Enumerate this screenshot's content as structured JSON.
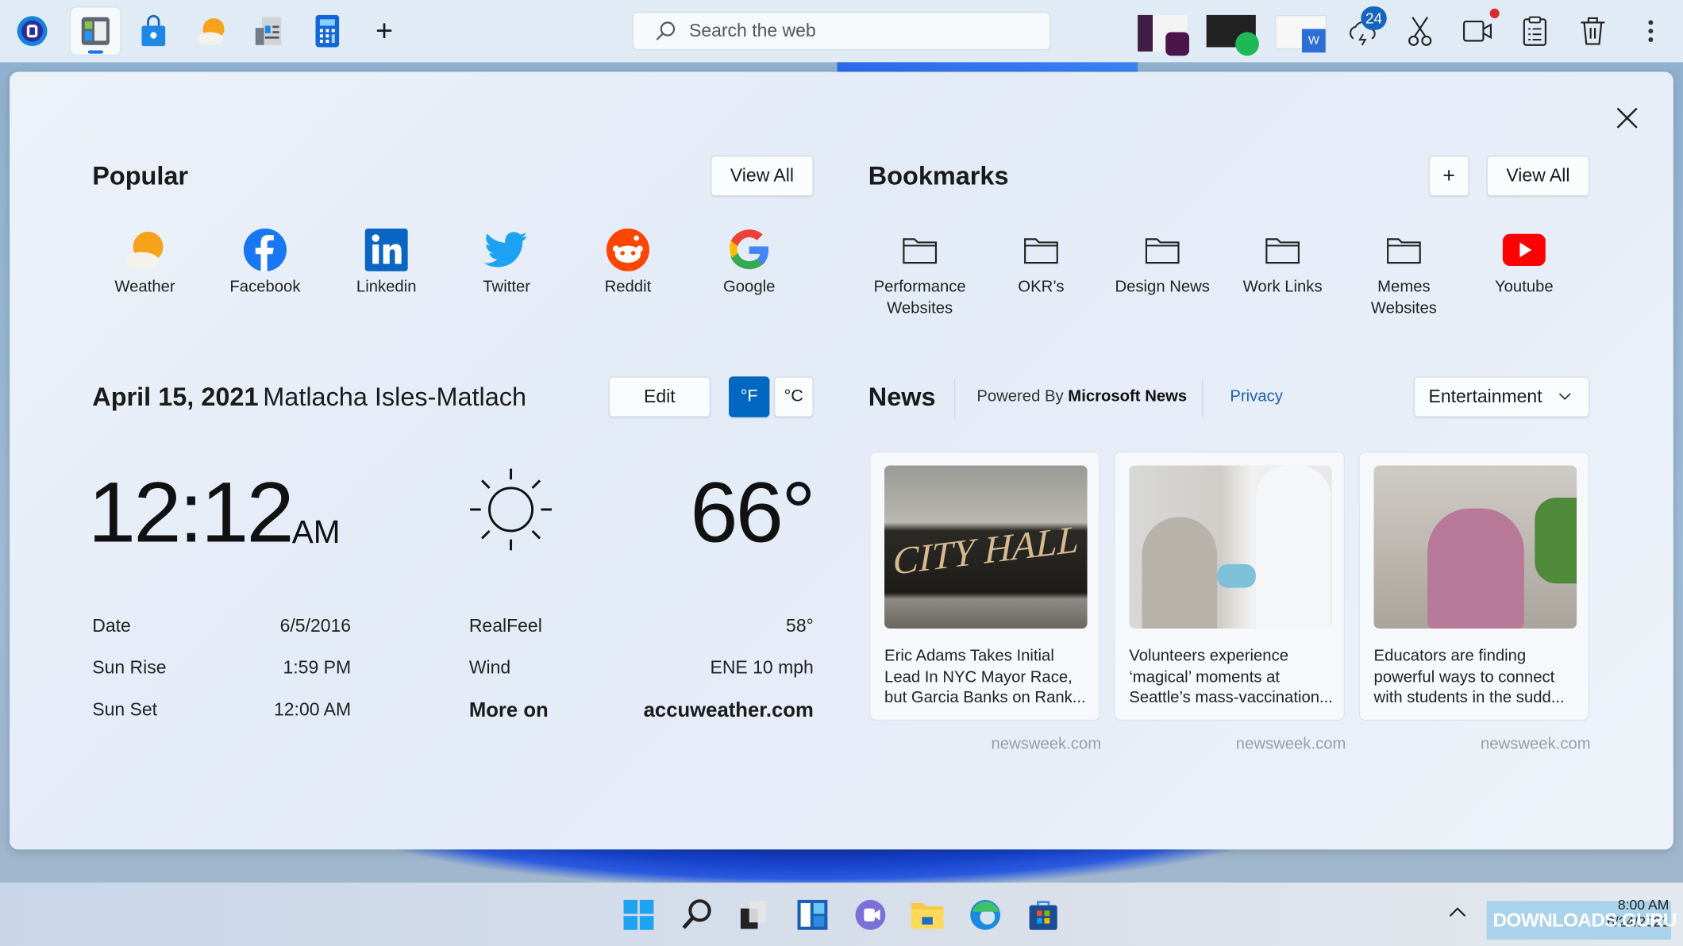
{
  "topbar": {
    "apps": [
      "cortana-icon",
      "widgets-icon",
      "store-bag-icon",
      "weather-icon",
      "news-icon",
      "calculator-icon"
    ],
    "add_label": "+",
    "search_placeholder": "Search the web",
    "thumbnails": [
      "slack-window",
      "spotify-window",
      "word-window"
    ],
    "weather_badge": "24",
    "tools": [
      "scissors-icon",
      "video-camera-icon",
      "clipboard-icon",
      "trash-icon",
      "more-icon"
    ]
  },
  "popular": {
    "title": "Popular",
    "view_all": "View All",
    "items": [
      {
        "label": "Weather",
        "icon": "weather-icon"
      },
      {
        "label": "Facebook",
        "icon": "facebook-icon",
        "color": "#1877f2"
      },
      {
        "label": "Linkedin",
        "icon": "linkedin-icon",
        "color": "#0a66c2"
      },
      {
        "label": "Twitter",
        "icon": "twitter-icon",
        "color": "#1da1f2"
      },
      {
        "label": "Reddit",
        "icon": "reddit-icon",
        "color": "#ff4500"
      },
      {
        "label": "Google",
        "icon": "google-icon"
      }
    ]
  },
  "bookmarks": {
    "title": "Bookmarks",
    "add": "+",
    "view_all": "View All",
    "items": [
      {
        "label": "Performance Websites",
        "icon": "folder-icon"
      },
      {
        "label": "OKR’s",
        "icon": "folder-icon"
      },
      {
        "label": "Design News",
        "icon": "folder-icon"
      },
      {
        "label": "Work Links",
        "icon": "folder-icon"
      },
      {
        "label": "Memes Websites",
        "icon": "folder-icon"
      },
      {
        "label": "Youtube",
        "icon": "youtube-icon",
        "color": "#ff0000"
      }
    ]
  },
  "weather": {
    "date": "April 15, 2021",
    "location": "Matlacha Isles-Matlach",
    "edit": "Edit",
    "unit_f": "°F",
    "unit_c": "°C",
    "active_unit": "F",
    "accent": "#0067c0",
    "time": "12:12",
    "ampm": "AM",
    "condition_icon": "sun-icon",
    "temperature": "66°",
    "left_rows": [
      {
        "label": "Date",
        "value": "6/5/2016"
      },
      {
        "label": "Sun Rise",
        "value": "1:59 PM"
      },
      {
        "label": "Sun Set",
        "value": "12:00 AM"
      }
    ],
    "right_rows": [
      {
        "label": "RealFeel",
        "value": "58°"
      },
      {
        "label": "Wind",
        "value": "ENE 10 mph"
      }
    ],
    "more_on": "More on",
    "more_link": "accuweather.com"
  },
  "news": {
    "title": "News",
    "powered_by": "Powered By",
    "provider": "Microsoft News",
    "privacy": "Privacy",
    "category": "Entertainment",
    "cards": [
      {
        "title": "Eric Adams Takes Initial Lead In NYC Mayor Race, but Garcia Banks on Rank...",
        "source": "newsweek.com",
        "image_text": "CITY HALL"
      },
      {
        "title": "Volunteers experience ‘magical’ moments at Seattle’s mass-vaccination...",
        "source": "newsweek.com"
      },
      {
        "title": "Educators are finding powerful ways to connect with students in the sudd...",
        "source": "newsweek.com"
      }
    ]
  },
  "taskbar": {
    "apps": [
      "start-icon",
      "search-icon",
      "task-view-icon",
      "widgets-icon",
      "teams-chat-icon",
      "file-explorer-icon",
      "edge-icon",
      "store-icon"
    ],
    "tray_time": "8:00 AM",
    "tray_date": "6/24/2021",
    "watermark": "DOWNLOADS.GURU"
  }
}
